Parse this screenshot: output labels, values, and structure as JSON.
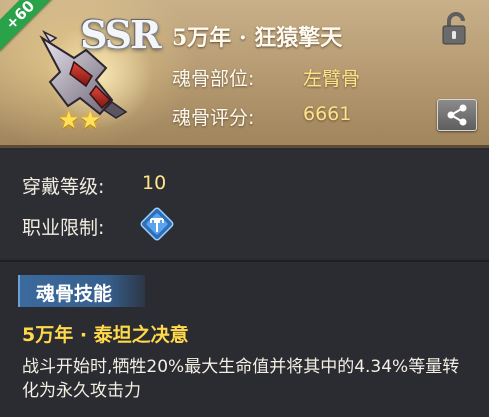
{
  "header": {
    "level_badge": "+60",
    "rarity": "SSR",
    "stars": 2,
    "title": "5万年 · 狂猿擎天",
    "rows": [
      {
        "label": "魂骨部位:",
        "value": "左臂骨"
      },
      {
        "label": "魂骨评分:",
        "value": "6661"
      }
    ],
    "icons": {
      "lock": "unlock-icon",
      "share": "share-icon",
      "item": "arm-bone-icon"
    }
  },
  "details": {
    "equip_label": "穿戴等级:",
    "equip_value": "10",
    "class_label": "职业限制:",
    "class_icon": "class-restriction-icon"
  },
  "skill": {
    "section_title": "魂骨技能",
    "name": "5万年 · 泰坦之决意",
    "description": "战斗开始时,牺牲20%最大生命值并将其中的4.34%等量转化为永久攻击力"
  },
  "colors": {
    "accent_gold": "#ffe58a",
    "skill_name": "#ffd94a",
    "level_badge": "#2aa24a",
    "section_tag": "#3b6a9c"
  }
}
